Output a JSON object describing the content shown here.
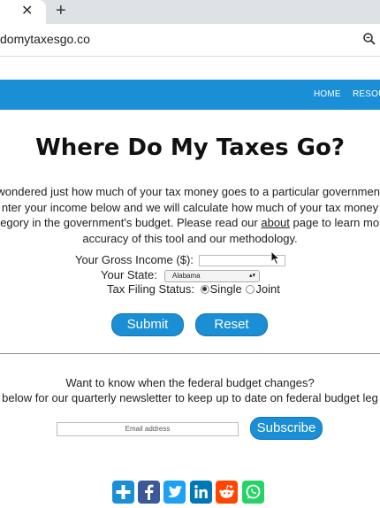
{
  "browser": {
    "tab_close_glyph": "✕",
    "new_tab_glyph": "+",
    "url": "domytaxesgo.co",
    "zoom_icon": "zoom-icon"
  },
  "nav": {
    "home": "HOME",
    "resources": "RESOU"
  },
  "page_title": "Where Do My Taxes Go?",
  "intro": {
    "line1": "wondered just how much of your tax money goes to a particular government",
    "line2": "nter your income below and we will calculate how much of your tax money",
    "line3_pre": "tegory in the government's budget. Please read our ",
    "line3_link": "about",
    "line3_post": " page to learn mor",
    "line4": "accuracy of this tool and our methodology."
  },
  "form": {
    "income_label": "Your Gross Income ($):",
    "income_value": "",
    "state_label": "Your State:",
    "state_selected": "Alabama",
    "status_label": "Tax Filing Status:",
    "status_single": "Single",
    "status_joint": "Joint",
    "status_selected": "Single",
    "submit": "Submit",
    "reset": "Reset"
  },
  "newsletter": {
    "line1": "Want to know when the federal budget changes?",
    "line2": "below for our quarterly newsletter to keep up to date on federal budget leg",
    "email_placeholder": "Email address",
    "subscribe": "Subscribe"
  },
  "share": [
    {
      "icon": "addthis-icon",
      "color": "#1a8fd6"
    },
    {
      "icon": "facebook-icon",
      "color": "#3b5998"
    },
    {
      "icon": "twitter-icon",
      "color": "#1da1f2"
    },
    {
      "icon": "linkedin-icon",
      "color": "#0077b5"
    },
    {
      "icon": "reddit-icon",
      "color": "#ff4500"
    },
    {
      "icon": "whatsapp-icon",
      "color": "#25d366"
    }
  ]
}
